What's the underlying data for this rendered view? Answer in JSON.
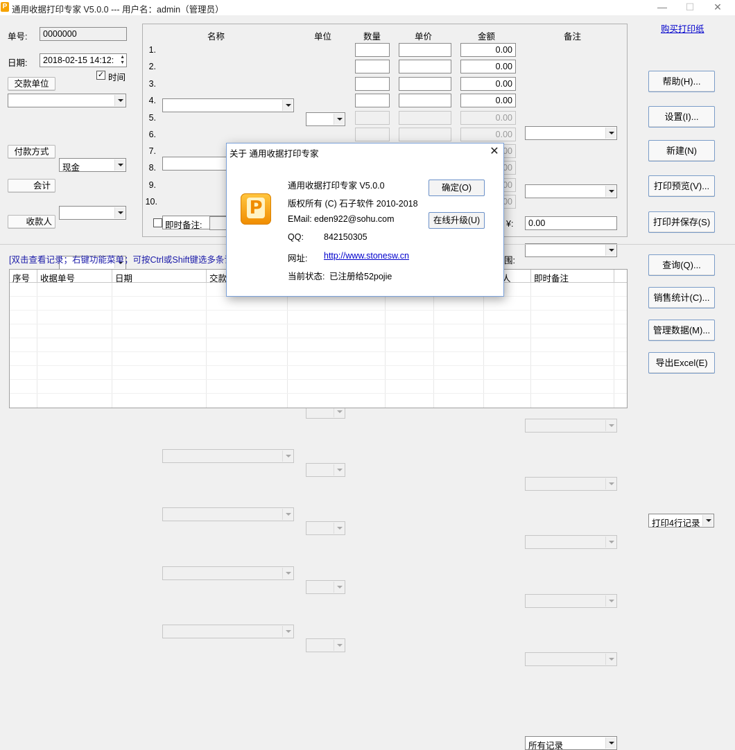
{
  "window": {
    "title": "通用收据打印专家 V5.0.0 --- 用户名：admin（管理员）",
    "icon": "P"
  },
  "header": {
    "receipt_no_label": "单号:",
    "receipt_no_value": "0000000",
    "date_label": "日期:",
    "date_value": "2018-02-15 14:12:",
    "time_checkbox_label": "时间",
    "party_button": "交款单位",
    "party_value": "",
    "payment_method_button": "付款方式",
    "payment_method_value": "现金",
    "accountant_button": "会计",
    "accountant_value": "",
    "payee_button": "收款人",
    "payee_value": ""
  },
  "items_table": {
    "columns": [
      "名称",
      "单位",
      "数量",
      "单价",
      "金额",
      "备注"
    ],
    "rows": [
      {
        "no": "1.",
        "amount": "0.00"
      },
      {
        "no": "2.",
        "amount": "0.00"
      },
      {
        "no": "3.",
        "amount": "0.00"
      },
      {
        "no": "4.",
        "amount": "0.00"
      },
      {
        "no": "5.",
        "amount": "0.00"
      },
      {
        "no": "6.",
        "amount": "0.00"
      },
      {
        "no": "7.",
        "amount": "0.00"
      },
      {
        "no": "8.",
        "amount": "0.00"
      },
      {
        "no": "9.",
        "amount": "0.00"
      },
      {
        "no": "10.",
        "amount": "0.00"
      }
    ],
    "instant_note_label": "即时备注:",
    "total_symbol": "¥:",
    "total_value": "0.00"
  },
  "right_panel": {
    "buy_link": "购买打印纸",
    "print_mode": "打印4行记录",
    "help_button": "帮助(H)...",
    "settings_button": "设置(I)...",
    "new_button": "新建(N)",
    "preview_button": "打印预览(V)...",
    "print_save_button": "打印并保存(S)",
    "query_button": "查询(Q)...",
    "sales_stats_button": "销售统计(C)...",
    "manage_data_button": "管理数据(M)...",
    "export_excel_button": "导出Excel(E)"
  },
  "records": {
    "hint": "[双击查看记录；右键功能菜单；可按Ctrl或Shift键选多条记录",
    "range_label": "围:",
    "range_value": "所有记录",
    "columns": [
      "序号",
      "收据单号",
      "日期",
      "交款",
      "人",
      "即时备注"
    ]
  },
  "dialog": {
    "title": "关于 通用收据打印专家",
    "logo_letter": "P",
    "product": "通用收据打印专家 V5.0.0",
    "copyright": "版权所有 (C) 石子软件 2010-2018",
    "email_label": "EMail:",
    "email_value": "eden922@sohu.com",
    "qq_label": "QQ:",
    "qq_value": "842150305",
    "url_label": "网址:",
    "url_value": "http://www.stonesw.cn",
    "status_label": "当前状态:",
    "status_value": "已注册给52pojie",
    "ok_button": "确定(O)",
    "upgrade_button": "在线升级(U)"
  }
}
